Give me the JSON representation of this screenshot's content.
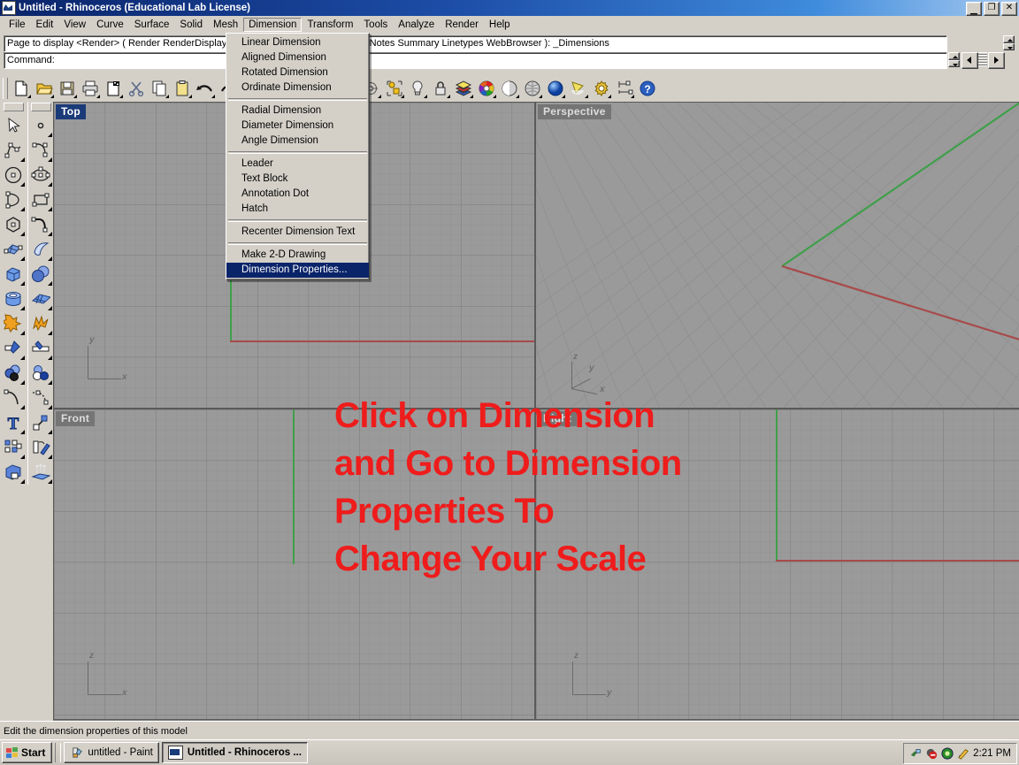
{
  "window": {
    "title": "Untitled - Rhinoceros (Educational Lab License)",
    "app_icon": "rhinoceros-icon",
    "minimize_label": "_",
    "maximize_label": "❐",
    "close_label": "✕"
  },
  "menubar": {
    "items": [
      {
        "label": "File",
        "open": false
      },
      {
        "label": "Edit",
        "open": false
      },
      {
        "label": "View",
        "open": false
      },
      {
        "label": "Curve",
        "open": false
      },
      {
        "label": "Surface",
        "open": false
      },
      {
        "label": "Solid",
        "open": false
      },
      {
        "label": "Mesh",
        "open": false
      },
      {
        "label": "Dimension",
        "open": true
      },
      {
        "label": "Transform",
        "open": false
      },
      {
        "label": "Tools",
        "open": false
      },
      {
        "label": "Analyze",
        "open": false
      },
      {
        "label": "Render",
        "open": false
      },
      {
        "label": "Help",
        "open": false
      }
    ]
  },
  "command_area": {
    "history_line": "Page to display <Render> ( Render RenderDisplay Layers Dimensions Default Grid Notes Summary Linetypes WebBrowser ): _Dimensions",
    "prompt_label": "Command:",
    "prompt_value": ""
  },
  "dropdown": {
    "owner": "Dimension",
    "groups": [
      {
        "items": [
          {
            "label": "Linear Dimension",
            "selected": false
          },
          {
            "label": "Aligned Dimension",
            "selected": false
          },
          {
            "label": "Rotated Dimension",
            "selected": false
          },
          {
            "label": "Ordinate Dimension",
            "selected": false
          }
        ]
      },
      {
        "items": [
          {
            "label": "Radial Dimension",
            "selected": false
          },
          {
            "label": "Diameter Dimension",
            "selected": false
          },
          {
            "label": "Angle Dimension",
            "selected": false
          }
        ]
      },
      {
        "items": [
          {
            "label": "Leader",
            "selected": false
          },
          {
            "label": "Text Block",
            "selected": false
          },
          {
            "label": "Annotation Dot",
            "selected": false
          },
          {
            "label": "Hatch",
            "selected": false
          }
        ]
      },
      {
        "items": [
          {
            "label": "Recenter Dimension Text",
            "selected": false
          }
        ]
      },
      {
        "items": [
          {
            "label": "Make 2-D Drawing",
            "selected": false
          },
          {
            "label": "Dimension Properties...",
            "selected": true
          }
        ]
      }
    ]
  },
  "toolbar": {
    "buttons": [
      {
        "name": "new-file-icon",
        "title": "New"
      },
      {
        "name": "open-folder-icon",
        "title": "Open"
      },
      {
        "name": "save-disk-icon",
        "title": "Save"
      },
      {
        "name": "print-icon",
        "title": "Print"
      },
      {
        "name": "cut-page-icon",
        "title": "Cut Page"
      },
      {
        "name": "scissors-cut-icon",
        "title": "Cut"
      },
      {
        "name": "copy-icon",
        "title": "Copy"
      },
      {
        "name": "paste-clipboard-icon",
        "title": "Paste"
      },
      {
        "name": "undo-arrow-icon",
        "title": "Undo"
      },
      {
        "name": "redo-arrow-icon",
        "title": "Redo"
      },
      {
        "name": "zoom-window-icon",
        "title": "Zoom Window"
      },
      {
        "name": "zoom-extents-icon",
        "title": "Zoom Extents"
      },
      {
        "name": "pan-rotate-icon",
        "title": "Rotate View"
      },
      {
        "name": "four-viewport-icon",
        "title": "4 Viewports"
      },
      {
        "name": "car-render-icon",
        "title": "Render"
      },
      {
        "name": "grid-plane-icon",
        "title": "Construction Plane"
      },
      {
        "name": "named-cplane-icon",
        "title": "Named CPlane"
      },
      {
        "name": "group-objects-icon",
        "title": "Group"
      },
      {
        "name": "light-bulb-icon",
        "title": "Lights"
      },
      {
        "name": "lock-padlock-icon",
        "title": "Lock Object"
      },
      {
        "name": "layer-colors-icon",
        "title": "Layers"
      },
      {
        "name": "color-wheel-icon",
        "title": "Object Color"
      },
      {
        "name": "shade-sphere-icon",
        "title": "Shade"
      },
      {
        "name": "render-mesh-icon",
        "title": "Render Mesh"
      },
      {
        "name": "render-preview-icon",
        "title": "Render Preview"
      },
      {
        "name": "spotlight-icon",
        "title": "Spotlight"
      },
      {
        "name": "gear-options-icon",
        "title": "Options"
      },
      {
        "name": "dimension-tool-icon",
        "title": "Dimension"
      },
      {
        "name": "help-question-icon",
        "title": "Help"
      }
    ]
  },
  "sidebar": {
    "column_left": [
      {
        "name": "select-arrow-icon"
      },
      {
        "name": "polyline-icon"
      },
      {
        "name": "circle-icon"
      },
      {
        "name": "arc-icon"
      },
      {
        "name": "polygon-icon"
      },
      {
        "name": "surface-patch-icon"
      },
      {
        "name": "box-solid-icon"
      },
      {
        "name": "cylinder-icon"
      },
      {
        "name": "boolean-union-icon"
      },
      {
        "name": "split-icon"
      },
      {
        "name": "boolean-spheres-icon"
      },
      {
        "name": "fillet-curve-icon"
      },
      {
        "name": "text-tool-icon"
      },
      {
        "name": "array-icon"
      },
      {
        "name": "cap-solid-icon"
      }
    ],
    "column_right": [
      {
        "name": "point-icon"
      },
      {
        "name": "curve-interp-icon"
      },
      {
        "name": "ellipse-icon"
      },
      {
        "name": "rectangle-icon"
      },
      {
        "name": "blend-curve-icon"
      },
      {
        "name": "surface-sweep-icon"
      },
      {
        "name": "sphere-icon"
      },
      {
        "name": "surface-grid-icon"
      },
      {
        "name": "explode-star-icon"
      },
      {
        "name": "trim-icon"
      },
      {
        "name": "boolean-difference-icon"
      },
      {
        "name": "fillet-dots-icon"
      },
      {
        "name": "move-arrow-icon"
      },
      {
        "name": "rotate-object-icon"
      },
      {
        "name": "extrude-up-icon"
      }
    ]
  },
  "viewports": [
    {
      "name": "top-viewport",
      "label": "Top",
      "active": true,
      "axis_labels": [
        "y",
        "x"
      ],
      "axis_type": "2d-xy"
    },
    {
      "name": "perspective-viewport",
      "label": "Perspective",
      "active": false,
      "axis_labels": [
        "z",
        "y",
        "x"
      ],
      "axis_type": "3d"
    },
    {
      "name": "front-viewport",
      "label": "Front",
      "active": false,
      "axis_labels": [
        "z",
        "x"
      ],
      "axis_type": "2d-zx"
    },
    {
      "name": "right-viewport",
      "label": "Right",
      "active": false,
      "axis_labels": [
        "z",
        "y"
      ],
      "axis_type": "2d-zy"
    }
  ],
  "annotation": {
    "text": "Click on Dimension and Go to Dimension Properties To Change Your Scale",
    "color": "#ef1c1c"
  },
  "statusbar": {
    "text": "Edit the dimension properties of this model"
  },
  "taskbar": {
    "start_label": "Start",
    "tasks": [
      {
        "label": "untitled - Paint",
        "icon": "paint-icon",
        "active": false
      },
      {
        "label": "Untitled - Rhinoceros ...",
        "icon": "rhinoceros-icon",
        "active": true
      }
    ],
    "tray_icons": [
      "network-icon",
      "antivirus-icon",
      "media-icon",
      "pencil-icon"
    ],
    "clock": "2:21 PM"
  },
  "colors": {
    "title_bar_start": "#0a246a",
    "title_bar_end": "#a6caf0",
    "face": "#d4d0c8",
    "menu_highlight": "#0a246a",
    "viewport_bg": "#9a9a9a",
    "viewport_label_active": "#1b3a78",
    "axis_x": "#a84a4a",
    "axis_y": "#3f9f4a",
    "annotation_red": "#ef1c1c"
  }
}
